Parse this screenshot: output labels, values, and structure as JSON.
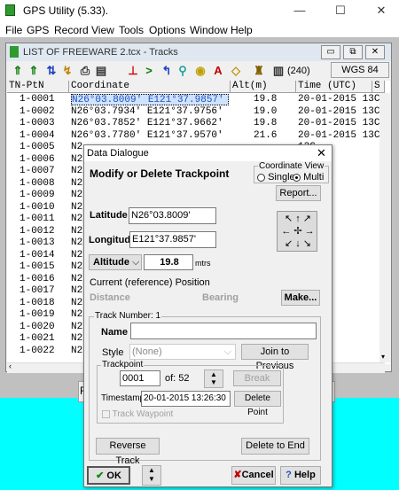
{
  "app": {
    "title": "GPS Utility (5.33).",
    "controls": [
      "—",
      "☐",
      "✕"
    ]
  },
  "menu": [
    "File",
    "GPS",
    "Record",
    "View",
    "Tools",
    "Options",
    "Window",
    "Help"
  ],
  "mdi": {
    "title": "LIST OF FREEWARE 2.tcx - Tracks",
    "count": "(240)",
    "datum": "WGS 84"
  },
  "table": {
    "headers": [
      "TN-PtN",
      "Coordinate",
      "Alt(m)",
      "Time (UTC)",
      "S"
    ],
    "rows": [
      [
        "1-0001",
        "N26°03.8009' E121°37.9857'",
        "19.8",
        "20-01-2015 13C"
      ],
      [
        "1-0002",
        "N26°03.7934' E121°37.9756'",
        "19.0",
        "20-01-2015 13C"
      ],
      [
        "1-0003",
        "N26°03.7852' E121°37.9662'",
        "19.8",
        "20-01-2015 13C"
      ],
      [
        "1-0004",
        "N26°03.7780' E121°37.9570'",
        "21.6",
        "20-01-2015 13C"
      ],
      [
        "1-0005",
        "N2",
        "",
        "13C"
      ],
      [
        "1-0006",
        "N2",
        "",
        "13C"
      ],
      [
        "1-0007",
        "N2",
        "",
        "13C"
      ],
      [
        "1-0008",
        "N2",
        "",
        "13C"
      ],
      [
        "1-0009",
        "N2",
        "",
        "13C"
      ],
      [
        "1-0010",
        "N2",
        "",
        "13C"
      ],
      [
        "1-0011",
        "N2",
        "",
        "13C"
      ],
      [
        "1-0012",
        "N2",
        "",
        "13C"
      ],
      [
        "1-0013",
        "N2",
        "",
        "13C"
      ],
      [
        "1-0014",
        "N2",
        "",
        "13C"
      ],
      [
        "1-0015",
        "N2",
        "",
        "13C"
      ],
      [
        "1-0016",
        "N2",
        "",
        "13C"
      ],
      [
        "1-0017",
        "N2",
        "",
        "13C"
      ],
      [
        "1-0018",
        "N2",
        "",
        "13C"
      ],
      [
        "1-0019",
        "N2",
        "",
        "13C"
      ],
      [
        "1-0020",
        "N2",
        "",
        "13C"
      ],
      [
        "1-0021",
        "N2",
        "",
        "13C"
      ],
      [
        "1-0022",
        "N2",
        "",
        "13C"
      ]
    ]
  },
  "dialog": {
    "title": "Data Dialogue",
    "close": "✕",
    "heading": "Modify or Delete Trackpoint",
    "coord_view": "Coordinate View",
    "single": "Single",
    "multi": "Multi",
    "report": "Report...",
    "lat_label": "Latitude",
    "lat": "N26°03.8009'",
    "lon_label": "Longitude",
    "lon": "E121°37.9857'",
    "alt_label": "Altitude",
    "alt": "19.8",
    "alt_unit": "mtrs",
    "ref_pos": "Current (reference) Position",
    "distance": "Distance",
    "bearing": "Bearing",
    "make": "Make...",
    "track_number": "Track Number: 1",
    "name_label": "Name",
    "style_label": "Style",
    "style_value": "(None)",
    "join": "Join to Previous",
    "trackpoint": "Trackpoint",
    "tp_num": "0001",
    "tp_of": "of: 52",
    "break": "Break",
    "ts_label": "Timestamp",
    "timestamp": "20-01-2015 13:26:30",
    "delete_point": "Delete Point",
    "track_waypoint": "Track Waypoint",
    "reverse": "Reverse Track",
    "delete_end": "Delete to End",
    "ok": "OK",
    "cancel": "Cancel",
    "help": "Help",
    "hidden_f": "F"
  }
}
